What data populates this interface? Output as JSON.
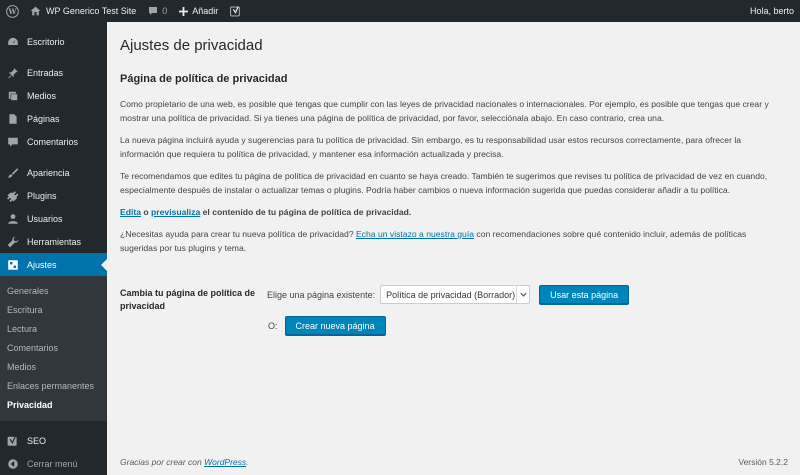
{
  "admin_bar": {
    "site_name": "WP Generico Test Site",
    "comments_count": "0",
    "add_new": "Añadir",
    "greeting": "Hola, berto"
  },
  "sidebar": {
    "items": [
      {
        "label": "Escritorio",
        "icon": "dashboard-icon"
      },
      {
        "label": "Entradas",
        "icon": "pin-icon"
      },
      {
        "label": "Medios",
        "icon": "media-icon"
      },
      {
        "label": "Páginas",
        "icon": "pages-icon"
      },
      {
        "label": "Comentarios",
        "icon": "comment-icon"
      },
      {
        "label": "Apariencia",
        "icon": "brush-icon"
      },
      {
        "label": "Plugins",
        "icon": "plugin-icon"
      },
      {
        "label": "Usuarios",
        "icon": "users-icon"
      },
      {
        "label": "Herramientas",
        "icon": "wrench-icon"
      },
      {
        "label": "Ajustes",
        "icon": "settings-icon"
      }
    ],
    "submenu": [
      "Generales",
      "Escritura",
      "Lectura",
      "Comentarios",
      "Medios",
      "Enlaces permanentes",
      "Privacidad"
    ],
    "seo": "SEO",
    "collapse": "Cerrar menú"
  },
  "main": {
    "title": "Ajustes de privacidad",
    "section_title": "Página de política de privacidad",
    "p1": "Como propietario de una web, es posible que tengas que cumplir con las leyes de privacidad nacionales o internacionales. Por ejemplo, es posible que tengas que crear y mostrar una política de privacidad. Si ya tienes una página de política de privacidad, por favor, selecciónala abajo. En caso contrario, crea una.",
    "p2": "La nueva página incluirá ayuda y sugerencias para tu política de privacidad. Sin embargo, es tu responsabilidad usar estos recursos correctamente, para ofrecer la información que requiera tu política de privacidad, y mantener esa información actualizada y precisa.",
    "p3": "Te recomendamos que edites tu página de política de privacidad en cuanto se haya creado. También te sugerimos que revises tu política de privacidad de vez en cuando, especialmente después de instalar o actualizar temas o plugins. Podría haber cambios o nueva información sugerida que puedas considerar añadir a tu política.",
    "edit_link": "Edita",
    "edit_or": "o",
    "preview_link": "previsualiza",
    "edit_rest": "el contenido de tu página de política de privacidad.",
    "help_pre": "¿Necesitas ayuda para crear tu nueva política de privacidad?",
    "help_link": "Echa un vistazo a nuestra guía",
    "help_post": "con recomendaciones sobre qué contenido incluir, además de políticas sugeridas por tus plugins y tema.",
    "settings_label": "Cambia tu página de política de privacidad",
    "choose_label": "Elige una página existente:",
    "select_value": "Política de privacidad (Borrador)",
    "use_button": "Usar esta página",
    "or_label": "O:",
    "create_button": "Crear nueva página"
  },
  "footer": {
    "thanks_pre": "Gracias por crear con",
    "thanks_link": "WordPress",
    "thanks_post": ".",
    "version": "Versión 5.2.2"
  },
  "colors": {
    "admin_bg": "#23282d",
    "accent": "#0073aa",
    "button": "#0085ba",
    "content_bg": "#f1f1f1"
  }
}
